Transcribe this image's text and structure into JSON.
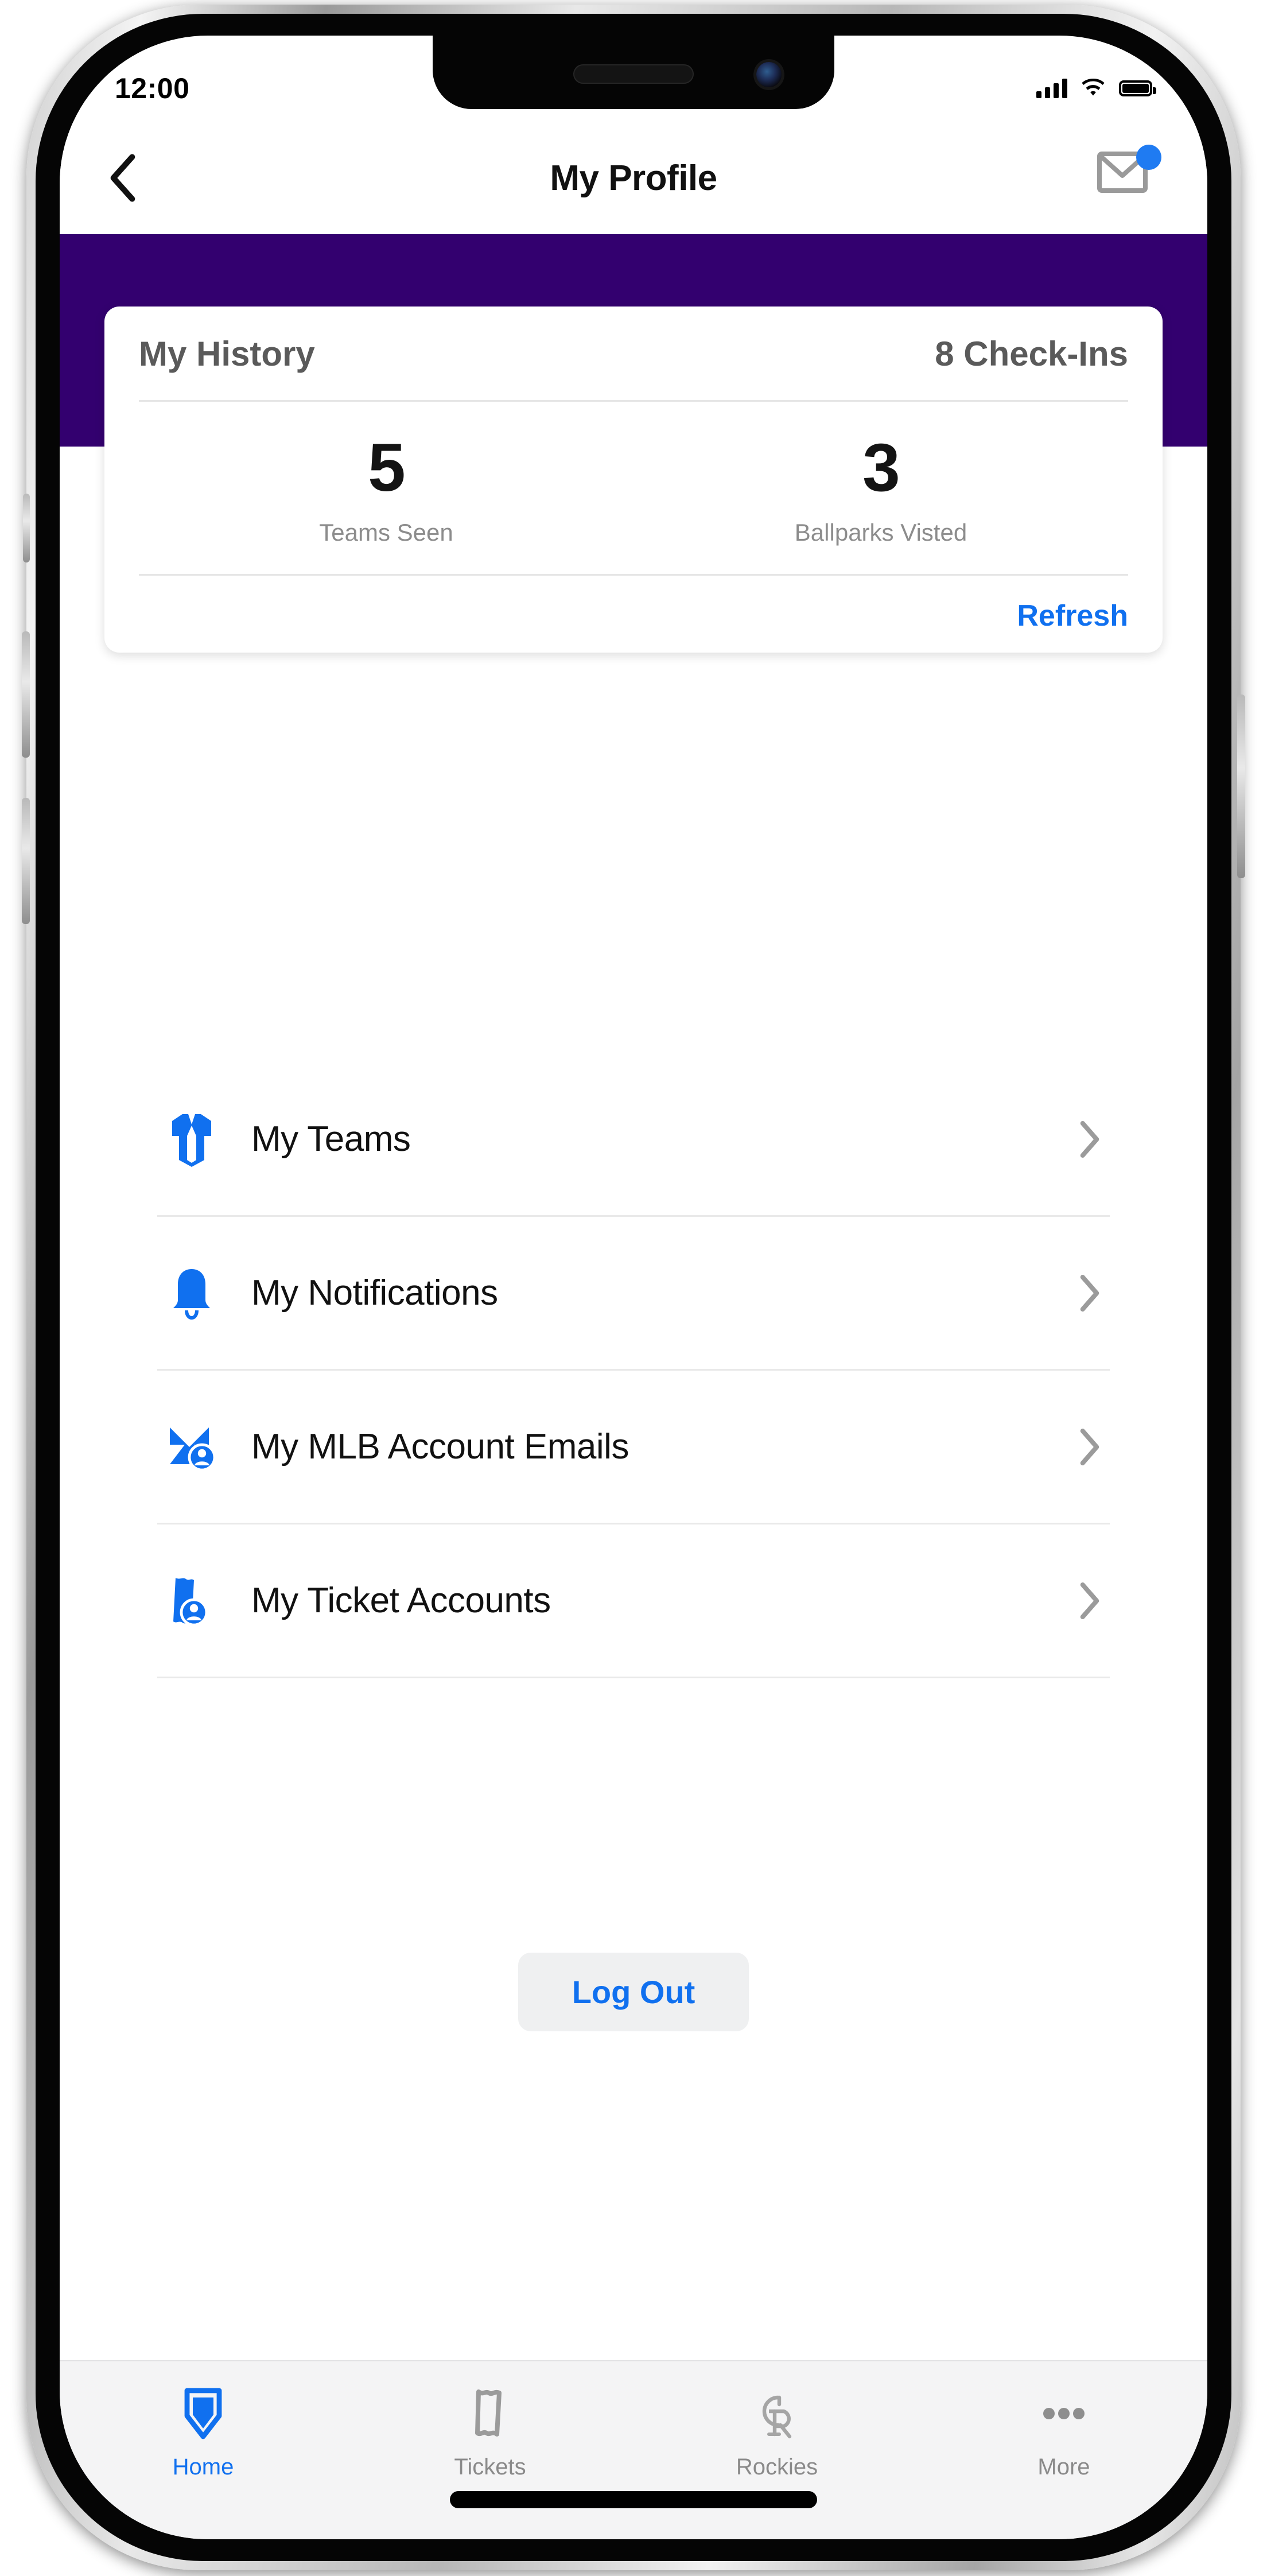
{
  "status_bar": {
    "time": "12:00",
    "signal_icon": "signal-bars-icon",
    "wifi_icon": "wifi-icon",
    "battery_icon": "battery-full-icon"
  },
  "nav": {
    "back_icon": "chevron-left-icon",
    "title": "My Profile",
    "mail_icon": "envelope-icon",
    "mail_has_badge": true
  },
  "theme": {
    "banner_color": "#33006F",
    "accent_blue": "#1070ef",
    "icon_blue": "#1070ef",
    "muted_gray": "#8a8a8a"
  },
  "history_card": {
    "title": "My History",
    "count_label": "8 Check-Ins",
    "stats": [
      {
        "value": "5",
        "label": "Teams Seen"
      },
      {
        "value": "3",
        "label": "Ballparks Visted"
      }
    ],
    "refresh_label": "Refresh"
  },
  "menu": {
    "items": [
      {
        "label": "My Teams",
        "icon": "jersey-icon",
        "chevron": "chevron-right-icon"
      },
      {
        "label": "My Notifications",
        "icon": "bell-icon",
        "chevron": "chevron-right-icon"
      },
      {
        "label": "My MLB Account Emails",
        "icon": "envelope-person-icon",
        "chevron": "chevron-right-icon"
      },
      {
        "label": "My Ticket Accounts",
        "icon": "ticket-person-icon",
        "chevron": "chevron-right-icon"
      }
    ]
  },
  "logout": {
    "label": "Log Out"
  },
  "tabbar": {
    "tabs": [
      {
        "label": "Home",
        "icon": "home-plate-icon",
        "active": true
      },
      {
        "label": "Tickets",
        "icon": "ticket-icon",
        "active": false
      },
      {
        "label": "Rockies",
        "icon": "rockies-cr-logo-icon",
        "active": false
      },
      {
        "label": "More",
        "icon": "ellipsis-icon",
        "active": false
      }
    ]
  }
}
